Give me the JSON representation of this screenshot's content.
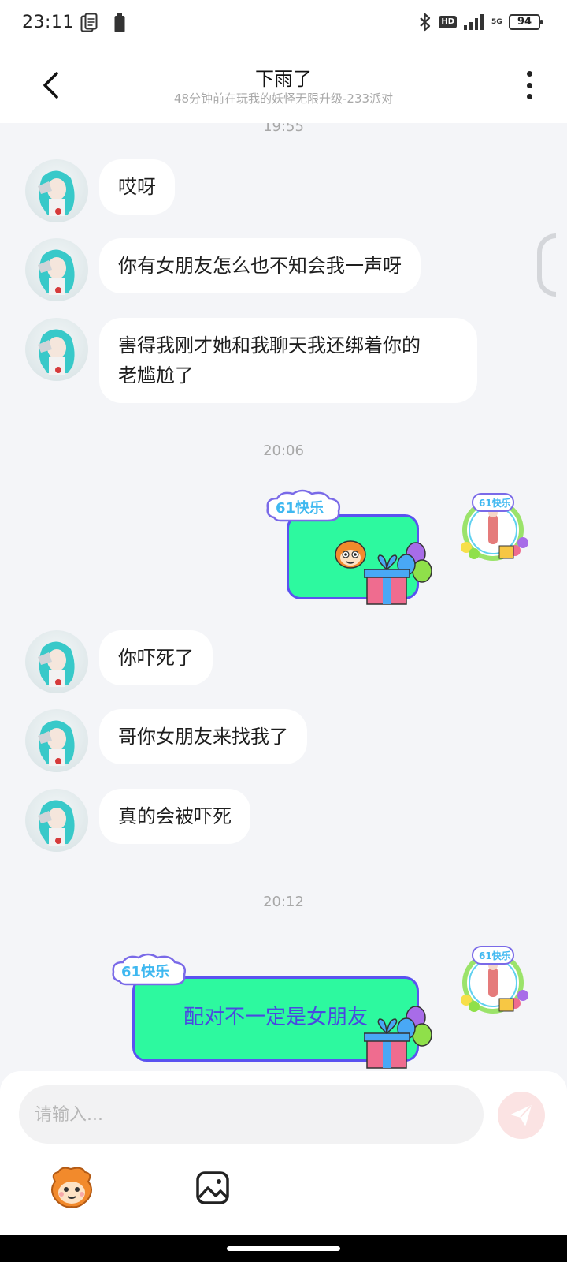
{
  "status_bar": {
    "time": "23:11",
    "hd": "HD",
    "network": "5G",
    "battery": "94"
  },
  "header": {
    "title": "下雨了",
    "subtitle": "48分钟前在玩我的妖怪无限升级-233派对"
  },
  "messages": {
    "partial_timestamp": "19:55",
    "m1": "哎呀",
    "m2": "你有女朋友怎么也不知会我一声呀",
    "m3": "害得我刚才她和我聊天我还绑着你的\n老尴尬了",
    "ts2": "20:06",
    "m4": "你吓死了",
    "m5": "哥你女朋友来找我了",
    "m6": "真的会被吓死",
    "ts3": "20:12",
    "card_badge": "61快乐",
    "card2_text": "配对不一定是女朋友"
  },
  "input": {
    "placeholder": "请输入..."
  },
  "colors": {
    "card_bg": "#2df99f",
    "card_border": "#5a52f0",
    "send_bg": "#fbe3e3"
  },
  "icons": [
    "back-arrow-icon",
    "more-icon",
    "send-icon",
    "emoji-icon",
    "image-icon"
  ]
}
